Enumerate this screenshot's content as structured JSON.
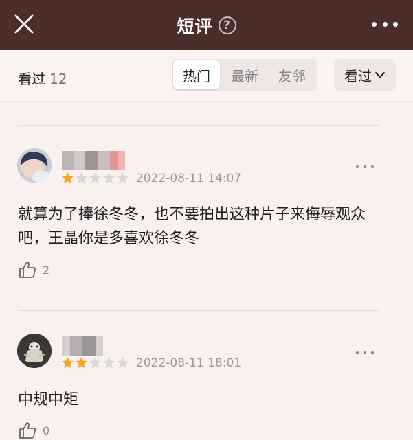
{
  "header": {
    "title": "短评",
    "help_icon": "question-circle-icon",
    "close_icon": "close-icon",
    "more_icon": "more-horizontal-icon"
  },
  "toolbar": {
    "seen_label": "看过",
    "seen_count": "12",
    "tabs": [
      {
        "label": "热门",
        "active": true
      },
      {
        "label": "最新",
        "active": false
      },
      {
        "label": "友邻",
        "active": false
      }
    ],
    "filter_label": "看过",
    "filter_icon": "chevron-down-icon"
  },
  "reviews": [
    {
      "rating": 1,
      "time": "2022-08-11 14:07",
      "content": "就算为了捧徐冬冬，也不要拍出这种片子来侮辱观众吧，王晶你是多喜欢徐冬冬",
      "likes": "2"
    },
    {
      "rating": 2,
      "time": "2022-08-11 18:01",
      "content": "中规中矩",
      "likes": "0"
    }
  ],
  "colors": {
    "header_bg": "#4b2e2a",
    "page_bg": "#fbf0f0",
    "star_active": "#f5a623",
    "star_inactive": "#d8d8d8"
  }
}
